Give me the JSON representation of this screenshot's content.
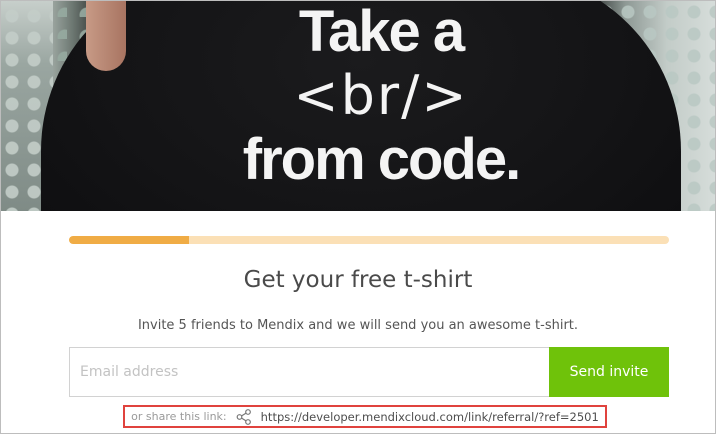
{
  "hero": {
    "shirt_text": {
      "line1": "Take a",
      "line2": "<br/>",
      "line3": "from code."
    }
  },
  "progress": {
    "value_fraction": 0.2
  },
  "title": "Get your free t-shirt",
  "subtitle": "Invite 5 friends to Mendix and we will send you an awesome t-shirt.",
  "form": {
    "email_placeholder": "Email address",
    "email_value": "",
    "send_label": "Send invite"
  },
  "share": {
    "label": "or share this link:",
    "icon": "share-icon",
    "link": "https://developer.mendixcloud.com/link/referral/?ref=2501"
  },
  "colors": {
    "accent_green": "#6fc20a",
    "progress_fill": "#f0ac45",
    "progress_track": "#fbe0b6",
    "highlight_box": "#e0433e"
  }
}
